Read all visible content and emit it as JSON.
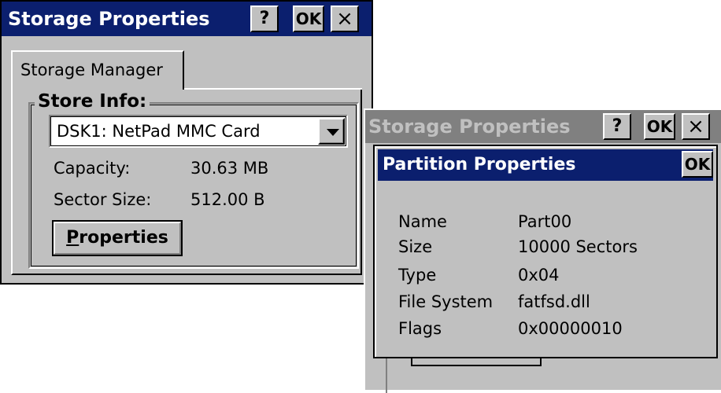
{
  "main_window": {
    "title": "Storage Properties",
    "help_label": "?",
    "ok_label": "OK",
    "close_label": "×",
    "tab_label": "Storage Manager",
    "group_title": "Store Info:",
    "store_value": "DSK1: NetPad MMC Card",
    "capacity_label": "Capacity:",
    "capacity_value": "30.63 MB",
    "sector_label": "Sector Size:",
    "sector_value": "512.00 B",
    "properties_button_accel": "P",
    "properties_button_rest": "roperties"
  },
  "background_window": {
    "title": "Storage Properties",
    "help_label": "?",
    "ok_label": "OK",
    "close_label": "×"
  },
  "partition_dialog": {
    "title": "Partition Properties",
    "ok_label": "OK",
    "rows": [
      {
        "label": "Name",
        "value": "Part00"
      },
      {
        "label": "Size",
        "value": "10000 Sectors"
      },
      {
        "label": "Type",
        "value": "0x04"
      },
      {
        "label": "File System",
        "value": "fatfsd.dll"
      },
      {
        "label": "Flags",
        "value": "0x00000010"
      }
    ]
  },
  "colors": {
    "active_title": "#0b1f6e",
    "inactive_title": "#808080",
    "face": "#c0c0c0"
  },
  "icons": [
    "dropdown-arrow-icon"
  ]
}
